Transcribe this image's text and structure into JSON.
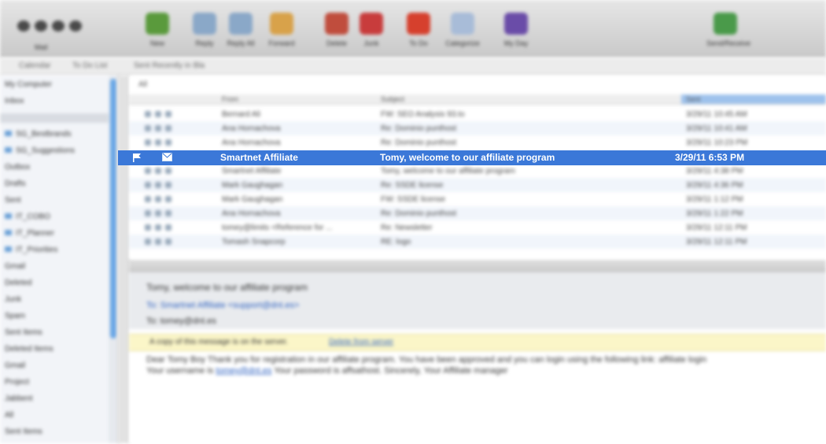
{
  "toolbar": {
    "mini_label": "Mail",
    "buttons": [
      {
        "label": "New",
        "icon": "new-message-icon",
        "color": "#5a9a3c"
      },
      {
        "label": "Reply",
        "icon": "reply-icon",
        "color": "#8aa8c8"
      },
      {
        "label": "Reply All",
        "icon": "reply-all-icon",
        "color": "#8aa8c8"
      },
      {
        "label": "Forward",
        "icon": "forward-icon",
        "color": "#d8a24a"
      },
      {
        "label": "Delete",
        "icon": "delete-icon",
        "color": "#c04d3d"
      },
      {
        "label": "Junk",
        "icon": "junk-icon",
        "color": "#c83c3c"
      },
      {
        "label": "To Do",
        "icon": "todo-flag-icon",
        "color": "#d6402d"
      },
      {
        "label": "Categorize",
        "icon": "categorize-icon",
        "color": "#a8bcd8"
      },
      {
        "label": "My Day",
        "icon": "my-day-icon",
        "color": "#6a4ca8"
      },
      {
        "label": "Send/Receive",
        "icon": "send-receive-icon",
        "color": "#4a9a4a"
      }
    ]
  },
  "subbar": {
    "tabs": [
      "Calendar",
      "To Do List",
      "Sent Recently in Bla"
    ]
  },
  "sidebar": {
    "items": [
      "My Computer",
      "Inbox",
      "",
      "SG_Bestbrands",
      "SG_Suggestions",
      "Outbox",
      "Drafts",
      "Sent",
      "IT_COBO",
      "IT_Planner",
      "IT_Priorities",
      "Gmail",
      "Deleted",
      "Junk",
      "Spam",
      "Sent Items",
      "Deleted Items",
      "Gmail",
      "Project",
      "Jabbent",
      "All",
      "Sent Items"
    ]
  },
  "list": {
    "title": "All",
    "headers": {
      "from": "From",
      "subject": "Subject",
      "sent": "Sent"
    },
    "rows": [
      {
        "from": "Bernard Ali",
        "subject": "FW: SEO Analysis 93.to",
        "date": "3/29/11 10:45 AM"
      },
      {
        "from": "Ana Hornachova",
        "subject": "Re: Dominio punthost",
        "date": "3/29/11 10:41 AM"
      },
      {
        "from": "Ana Hornachova",
        "subject": "Re: Dominio punthost",
        "date": "3/29/11 10:23 PM"
      },
      {
        "from": "Smartnet Affiliate",
        "subject": "Tomy, welcome to our affiliate program",
        "date": "3/29/11 6:53 PM",
        "selected": true
      },
      {
        "from": "Smartnet Affiliate",
        "subject": "Tomy, welcome to our affiliate program",
        "date": "3/29/11 4:38 PM"
      },
      {
        "from": "Mark Gaughagan",
        "subject": "Re: SSDE license",
        "date": "3/29/11 4:36 PM"
      },
      {
        "from": "Mark Gaughagan",
        "subject": "FW: SSDE license",
        "date": "3/29/11 1:12 PM"
      },
      {
        "from": "Ana Hornachova",
        "subject": "Re: Dominio punthost",
        "date": "3/29/11 1:22 PM"
      },
      {
        "from": "tomey@limits <Reference for ...",
        "subject": "Re: Newsletter",
        "date": "3/29/11 12:11 PM"
      },
      {
        "from": "Tomash Snapcorp",
        "subject": "RE: logo",
        "date": "3/29/11 12:11 PM"
      }
    ]
  },
  "preview": {
    "subject": "Tomy, welcome to our affiliate program",
    "from": "To: Smartnet Affiliate <support@dnt.es>",
    "to": "To: tomey@dnt.es",
    "notice": "A copy of this message is on the server.",
    "notice_link": "Delete from server",
    "body_line1": "Dear Tomy Boy Thank you for registration in our affiliate program. You have been approved and you can login using the following link: affiliate login",
    "body_line2_pre": "Your username is",
    "body_line2_link": "tomey@dnt.es",
    "body_line2_post": "Your password is affsathost. Sincerely, Your Affiliate manager"
  }
}
